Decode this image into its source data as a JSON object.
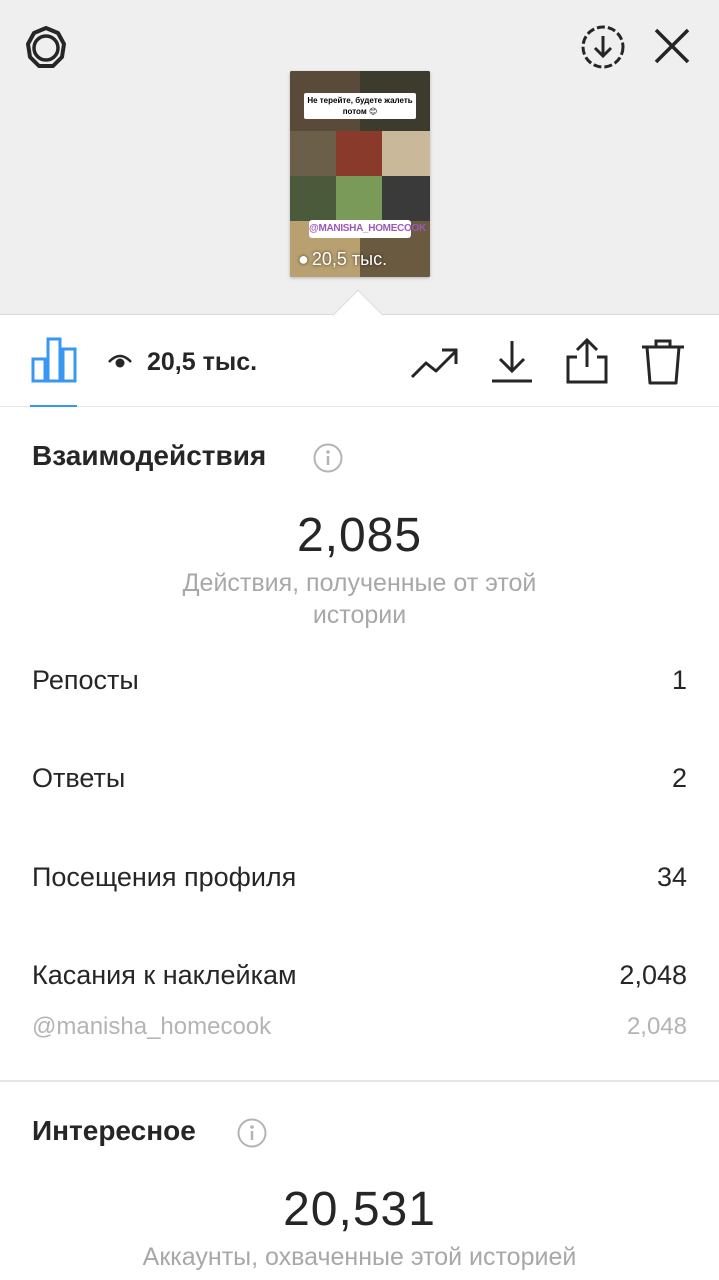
{
  "story_thumbnail": {
    "caption": "Не терейте, будете жалеть потом 😊",
    "sticker": "@MANISHA_HOMECOOK",
    "views": "20,5 тыс."
  },
  "toolbar": {
    "views_count": "20,5 тыс.",
    "active_tab_color": "#3897f0",
    "icons": [
      "insights-icon",
      "eye-icon",
      "promote-icon",
      "download-icon",
      "share-icon",
      "delete-icon"
    ]
  },
  "header_icons": [
    "settings-icon",
    "download-circle-icon",
    "close-icon"
  ],
  "interactions": {
    "title": "Взаимодействия",
    "total": "2,085",
    "subtitle": "Действия, полученные от этой истории",
    "rows": [
      {
        "label": "Репосты",
        "value": "1"
      },
      {
        "label": "Ответы",
        "value": "2"
      },
      {
        "label": "Посещения профиля",
        "value": "34"
      },
      {
        "label": "Касания к наклейкам",
        "value": "2,048"
      }
    ],
    "sub_row": {
      "label": "@manisha_homecook",
      "value": "2,048"
    }
  },
  "discovery": {
    "title": "Интересное",
    "total": "20,531",
    "subtitle": "Аккаунты, охваченные этой историей"
  }
}
